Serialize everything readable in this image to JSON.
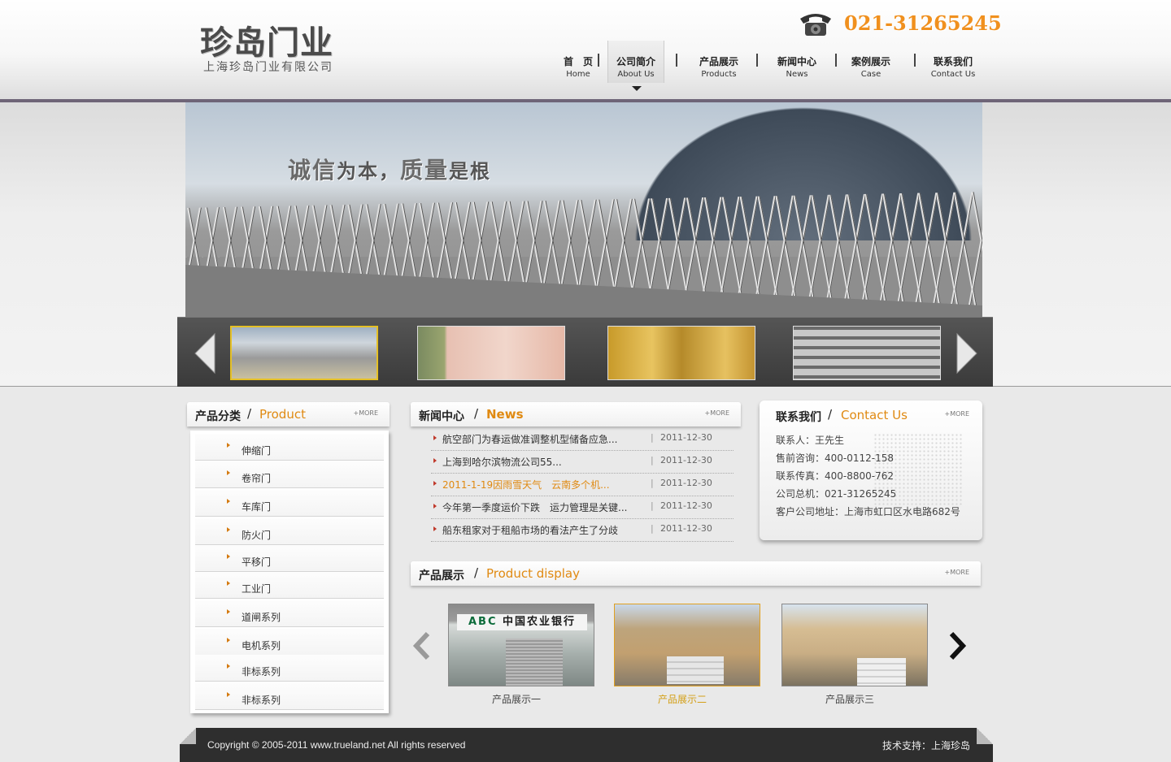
{
  "brand": {
    "name": "珍岛门业",
    "subtitle": "上海珍岛门业有限公司",
    "phone": "021-31265245"
  },
  "nav": [
    {
      "cn": "首　页",
      "en": "Home"
    },
    {
      "cn": "公司简介",
      "en": "About Us",
      "active": true
    },
    {
      "cn": "产品展示",
      "en": "Products"
    },
    {
      "cn": "新闻中心",
      "en": "News"
    },
    {
      "cn": "案例展示",
      "en": "Case"
    },
    {
      "cn": "联系我们",
      "en": "Contact Us"
    }
  ],
  "banner": {
    "slogan_a": "诚信",
    "slogan_b": "为本，",
    "slogan_c": "质量",
    "slogan_d": "是根"
  },
  "product_category": {
    "title_cn": "产品分类",
    "title_en": "Product",
    "more": "+MORE",
    "items": [
      "伸缩门",
      "卷帘门",
      "车库门",
      "防火门",
      "平移门",
      "工业门",
      "道闸系列",
      "电机系列",
      "非标系列",
      "非标系列"
    ]
  },
  "news": {
    "title_cn": "新闻中心",
    "title_en": "News",
    "more": "+MORE",
    "items": [
      {
        "title": "航空部门为春运做准调整机型储备应急...",
        "date": "2011-12-30"
      },
      {
        "title": "上海到哈尔滨物流公司55...",
        "date": "2011-12-30"
      },
      {
        "title": "2011-1-19因雨雪天气　云南多个机...",
        "date": "2011-12-30"
      },
      {
        "title": "今年第一季度运价下跌　运力管理是关键...",
        "date": "2011-12-30"
      },
      {
        "title": "船东租家对于租船市场的看法产生了分歧",
        "date": "2011-12-30"
      }
    ]
  },
  "contact": {
    "title_cn": "联系我们",
    "title_en": "Contact Us",
    "more": "+MORE",
    "lines": [
      "联系人：王先生",
      "售前咨询：400-0112-158",
      "联系传真：400-8800-762",
      "公司总机：021-31265245",
      "客户公司地址：上海市虹口区水电路682号"
    ]
  },
  "product_display": {
    "title_cn": "产品展示",
    "title_en": "Product display",
    "more": "+MORE",
    "items": [
      "产品展示一",
      "产品展示二",
      "产品展示三"
    ],
    "bank_sign": "中国农业银行",
    "bank_abbr": "ABC"
  },
  "footer": {
    "copyright": "Copyright © 2005-2011  www.trueland.net  All rights reserved",
    "tech": "技术支持：上海珍岛"
  },
  "colors": {
    "accent": "#e08a12",
    "phone": "#f0901e",
    "header_rule": "#6e6577",
    "footer_bg": "#2e2e2e",
    "thumb_selected": "#e5c025"
  }
}
